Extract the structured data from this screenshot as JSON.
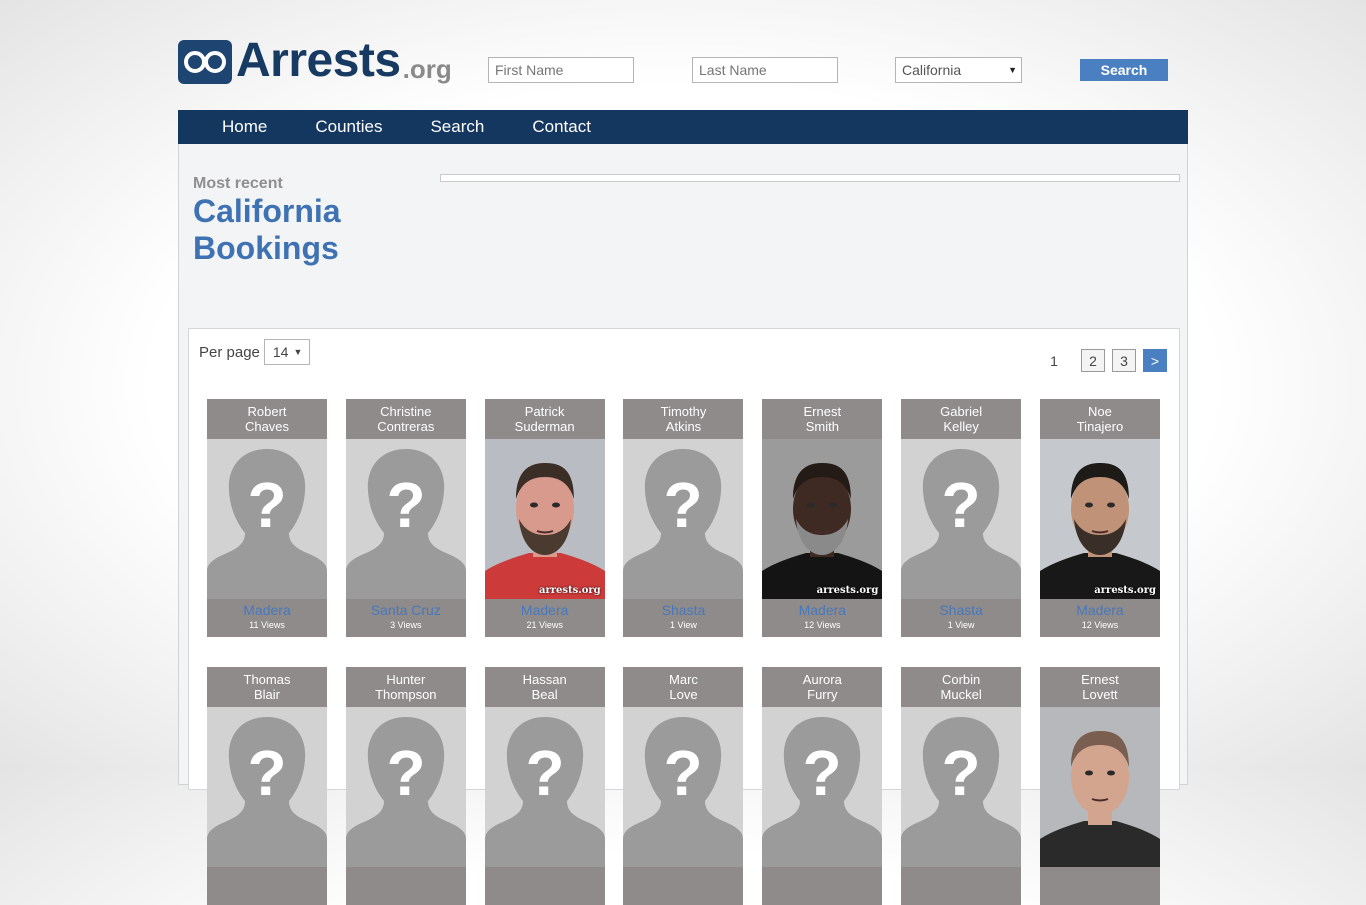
{
  "logo": {
    "main": "Arrests",
    "tld": ".org"
  },
  "search": {
    "first_placeholder": "First Name",
    "last_placeholder": "Last Name",
    "state_value": "California",
    "button_label": "Search"
  },
  "nav": {
    "home": "Home",
    "counties": "Counties",
    "search": "Search",
    "contact": "Contact"
  },
  "heading": {
    "most_recent": "Most recent",
    "title_line1": "California",
    "title_line2": "Bookings"
  },
  "listing": {
    "per_page_label": "Per page",
    "per_page_value": "14",
    "pages": {
      "current": "1",
      "p2": "2",
      "p3": "3",
      "next": ">"
    }
  },
  "watermark": "arrests.org",
  "bookings": [
    {
      "first": "Robert",
      "last": "Chaves",
      "county": "Madera",
      "views": "11 Views",
      "photo": "placeholder"
    },
    {
      "first": "Christine",
      "last": "Contreras",
      "county": "Santa Cruz",
      "views": "3 Views",
      "photo": "placeholder"
    },
    {
      "first": "Patrick",
      "last": "Suderman",
      "county": "Madera",
      "views": "21 Views",
      "photo": "mugshot-red-shirt"
    },
    {
      "first": "Timothy",
      "last": "Atkins",
      "county": "Shasta",
      "views": "1 View",
      "photo": "placeholder"
    },
    {
      "first": "Ernest",
      "last": "Smith",
      "county": "Madera",
      "views": "12 Views",
      "photo": "mugshot-dark"
    },
    {
      "first": "Gabriel",
      "last": "Kelley",
      "county": "Shasta",
      "views": "1 View",
      "photo": "placeholder"
    },
    {
      "first": "Noe",
      "last": "Tinajero",
      "county": "Madera",
      "views": "12 Views",
      "photo": "mugshot-black-shirt"
    },
    {
      "first": "Thomas",
      "last": "Blair",
      "county": "",
      "views": "",
      "photo": "placeholder"
    },
    {
      "first": "Hunter",
      "last": "Thompson",
      "county": "",
      "views": "",
      "photo": "placeholder"
    },
    {
      "first": "Hassan",
      "last": "Beal",
      "county": "",
      "views": "",
      "photo": "placeholder"
    },
    {
      "first": "Marc",
      "last": "Love",
      "county": "",
      "views": "",
      "photo": "placeholder"
    },
    {
      "first": "Aurora",
      "last": "Furry",
      "county": "",
      "views": "",
      "photo": "placeholder"
    },
    {
      "first": "Corbin",
      "last": "Muckel",
      "county": "",
      "views": "",
      "photo": "placeholder"
    },
    {
      "first": "Ernest",
      "last": "Lovett",
      "county": "",
      "views": "",
      "photo": "mugshot-shaved"
    }
  ]
}
